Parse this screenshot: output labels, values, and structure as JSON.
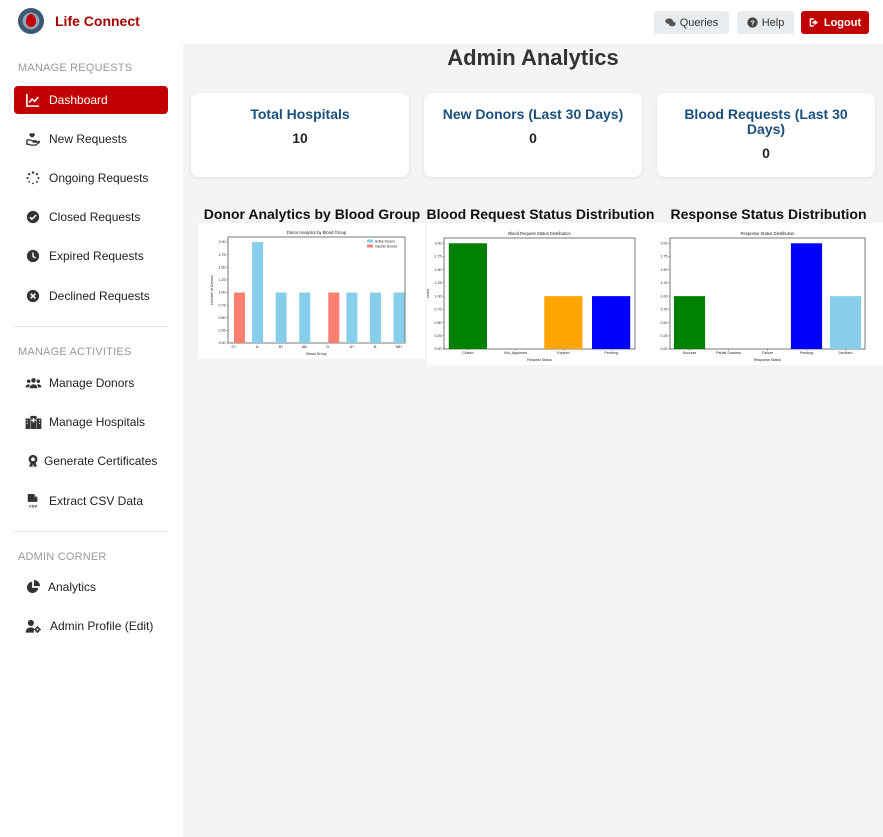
{
  "app": {
    "brand": "Life Connect"
  },
  "header": {
    "queries_label": "Queries",
    "help_label": "Help",
    "logout_label": "Logout"
  },
  "sidebar": {
    "sections": [
      {
        "title": "MANAGE REQUESTS",
        "items": [
          {
            "label": "Dashboard",
            "icon": "chart-line-icon",
            "active": true
          },
          {
            "label": "New Requests",
            "icon": "hand-heart-icon"
          },
          {
            "label": "Ongoing Requests",
            "icon": "spinner-icon"
          },
          {
            "label": "Closed Requests",
            "icon": "check-circle-icon"
          },
          {
            "label": "Expired Requests",
            "icon": "clock-icon"
          },
          {
            "label": "Declined Requests",
            "icon": "x-circle-icon"
          }
        ]
      },
      {
        "title": "MANAGE ACTIVITIES",
        "items": [
          {
            "label": "Manage Donors",
            "icon": "users-icon"
          },
          {
            "label": "Manage Hospitals",
            "icon": "hospital-icon"
          },
          {
            "label": "Generate Certificates",
            "icon": "award-icon"
          },
          {
            "label": "Extract CSV Data",
            "icon": "csv-file-icon"
          }
        ]
      },
      {
        "title": "ADMIN CORNER",
        "items": [
          {
            "label": "Analytics",
            "icon": "pie-chart-icon"
          },
          {
            "label": "Admin Profile (Edit)",
            "icon": "user-gear-icon"
          }
        ]
      }
    ]
  },
  "main": {
    "title": "Admin Analytics",
    "cards": [
      {
        "title": "Total Hospitals",
        "value": "10"
      },
      {
        "title": "New Donors (Last 30 Days)",
        "value": "0"
      },
      {
        "title": "Blood Requests (Last 30 Days)",
        "value": "0"
      }
    ],
    "chart_titles": [
      "Donor Analytics by Blood Group",
      "Blood Request Status Distribution",
      "Response Status Distribution"
    ]
  },
  "colors": {
    "brand_red": "#c00000",
    "card_title": "#1b4f7c",
    "bg_main": "#f3f4f6"
  },
  "chart_data": [
    {
      "type": "bar",
      "title": "Donor Analytics by Blood Group",
      "xlabel": "Blood Group",
      "ylabel": "Number of Donors",
      "categories": [
        "O+",
        "A-",
        "B+",
        "AB-",
        "O-",
        "A+",
        "B-",
        "AB+"
      ],
      "series": [
        {
          "name": "Active Donors",
          "color": "#87ceeb",
          "values": [
            0,
            2,
            1,
            1,
            0,
            1,
            1,
            1
          ]
        },
        {
          "name": "Inactive Donors",
          "color": "#fa8072",
          "values": [
            1,
            0,
            0,
            0,
            1,
            0,
            0,
            0
          ]
        }
      ],
      "yticks": [
        "0.00",
        "0.25",
        "0.50",
        "0.75",
        "1.00",
        "1.25",
        "1.50",
        "1.75",
        "2.00"
      ],
      "ylim": [
        0,
        2.1
      ],
      "legend": "top-right"
    },
    {
      "type": "bar",
      "title": "Blood Request Status Distribution",
      "xlabel": "Request Status",
      "ylabel": "Count",
      "categories": [
        "Closed",
        "Not_Approved",
        "Expired",
        "Pending"
      ],
      "values": [
        2,
        0,
        1,
        1
      ],
      "colors": [
        "#008000",
        "#ff0000",
        "#ffa500",
        "#0000ff"
      ],
      "yticks": [
        "0.00",
        "0.25",
        "0.50",
        "0.75",
        "1.00",
        "1.25",
        "1.50",
        "1.75",
        "2.00"
      ],
      "ylim": [
        0,
        2.1
      ]
    },
    {
      "type": "bar",
      "title": "Response Status Distribution",
      "xlabel": "Response Status",
      "ylabel": "Count",
      "categories": [
        "Success",
        "Partial Success",
        "Failure",
        "Pending",
        "Declined"
      ],
      "values": [
        1,
        0,
        0,
        2,
        1
      ],
      "colors": [
        "#008000",
        "#ffa500",
        "#ff0000",
        "#0000ff",
        "#87ceeb"
      ],
      "yticks": [
        "0.00",
        "0.25",
        "0.50",
        "0.75",
        "1.00",
        "1.25",
        "1.50",
        "1.75",
        "2.00"
      ],
      "ylim": [
        0,
        2.1
      ]
    }
  ]
}
